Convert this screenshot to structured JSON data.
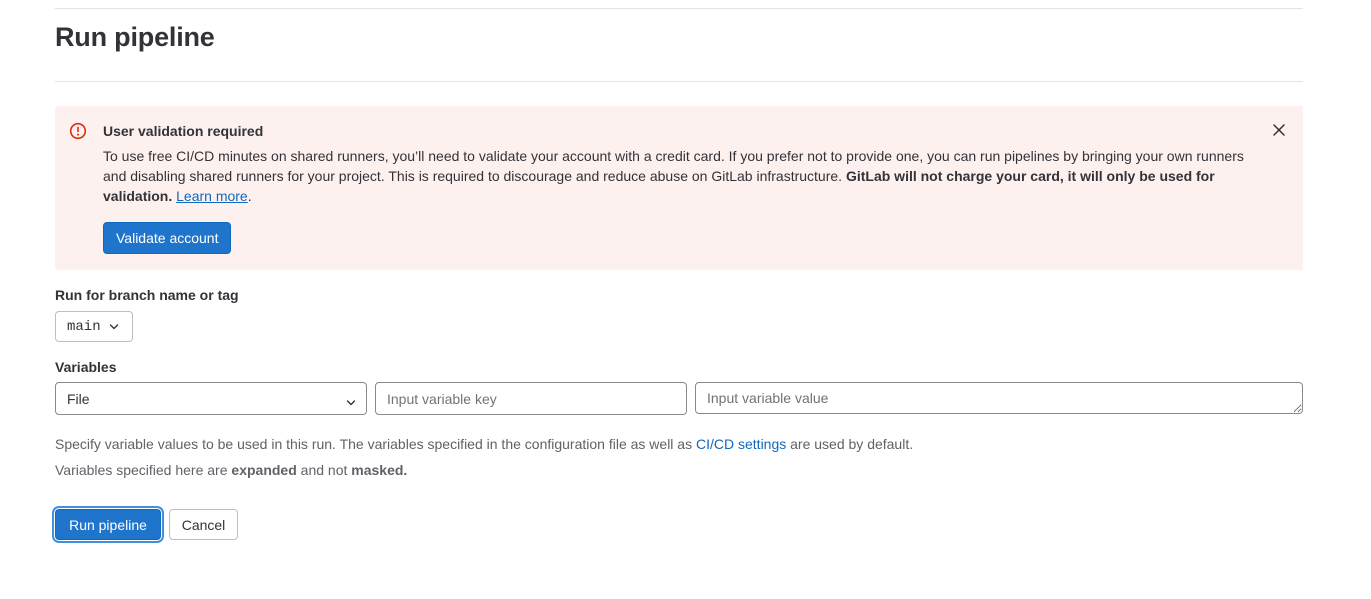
{
  "page": {
    "title": "Run pipeline"
  },
  "alert": {
    "title": "User validation required",
    "body_text": "To use free CI/CD minutes on shared runners, you’ll need to validate your account with a credit card. If you prefer not to provide one, you can run pipelines by bringing your own runners and disabling shared runners for your project. This is required to discourage and reduce abuse on GitLab infrastructure. ",
    "body_bold": "GitLab will not charge your card, it will only be used for validation.",
    "learn_more": "Learn more",
    "trailing": ".",
    "validate_button": "Validate account",
    "icon": "error-icon",
    "close_icon": "close-icon",
    "color": "#fcf1ef"
  },
  "branch": {
    "label": "Run for branch name or tag",
    "selected": "main",
    "icon": "chevron-down-icon"
  },
  "variables": {
    "label": "Variables",
    "type_selected": "File",
    "key_placeholder": "Input variable key",
    "value_placeholder": "Input variable value"
  },
  "help": {
    "line1_text": "Specify variable values to be used in this run. The variables specified in the configuration file as well as ",
    "line1_link": "CI/CD settings",
    "line1_trailing": " are used by default.",
    "line2_pre": "Variables specified here are ",
    "line2_bold1": "expanded",
    "line2_mid": " and not ",
    "line2_bold2": "masked."
  },
  "actions": {
    "run_label": "Run pipeline",
    "cancel_label": "Cancel"
  },
  "colors": {
    "primary": "#1f75cb",
    "link": "#1068bf",
    "danger": "#dd2b0e"
  }
}
